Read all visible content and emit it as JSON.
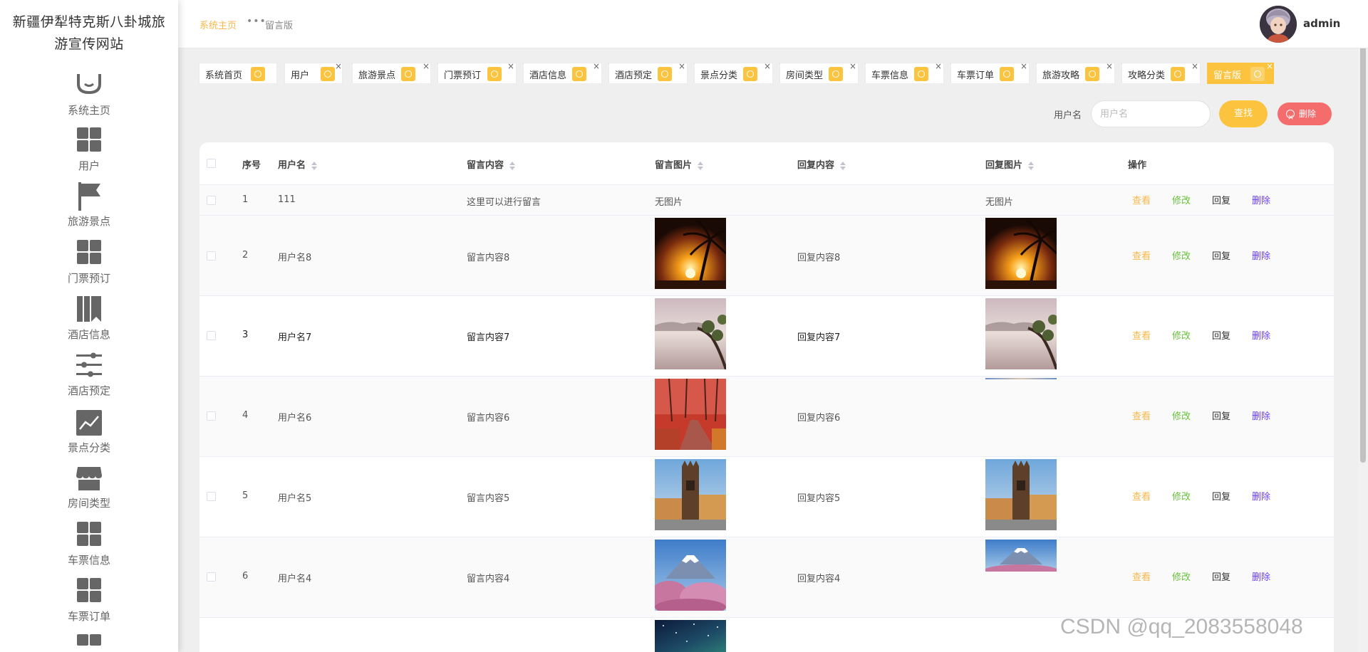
{
  "site": {
    "title_line1": "新疆伊犁特克斯八卦城旅",
    "title_line2": "游宣传网站"
  },
  "sidebar": {
    "items": [
      {
        "label": "系统主页",
        "icon": "home-icon"
      },
      {
        "label": "用户",
        "icon": "grid-icon"
      },
      {
        "label": "旅游景点",
        "icon": "flag-icon"
      },
      {
        "label": "门票预订",
        "icon": "grid-icon"
      },
      {
        "label": "酒店信息",
        "icon": "book-icon"
      },
      {
        "label": "酒店预定",
        "icon": "sliders-icon"
      },
      {
        "label": "景点分类",
        "icon": "chart-icon"
      },
      {
        "label": "房间类型",
        "icon": "shop-icon"
      },
      {
        "label": "车票信息",
        "icon": "grid-icon"
      },
      {
        "label": "车票订单",
        "icon": "grid-icon"
      }
    ]
  },
  "breadcrumb": {
    "home": "系统主页",
    "dots": "•••",
    "current": "留言版"
  },
  "user": {
    "name": "admin"
  },
  "tags": [
    {
      "label": "系统首页"
    },
    {
      "label": "用户"
    },
    {
      "label": "旅游景点"
    },
    {
      "label": "门票预订"
    },
    {
      "label": "酒店信息"
    },
    {
      "label": "酒店预定"
    },
    {
      "label": "景点分类"
    },
    {
      "label": "房间类型"
    },
    {
      "label": "车票信息"
    },
    {
      "label": "车票订单"
    },
    {
      "label": "旅游攻略"
    },
    {
      "label": "攻略分类"
    },
    {
      "label": "留言版"
    }
  ],
  "search": {
    "label": "用户名",
    "placeholder": "用户名",
    "search_btn": "查找",
    "delete_btn": "删除"
  },
  "table": {
    "headers": {
      "index": "序号",
      "username": "用户名",
      "content": "留言内容",
      "image": "留言图片",
      "reply": "回复内容",
      "reply_image": "回复图片",
      "actions": "操作"
    },
    "actions": {
      "view": "查看",
      "edit": "修改",
      "reply": "回复",
      "delete": "删除"
    },
    "no_image": "无图片",
    "rows": [
      {
        "index": "1",
        "username": "111",
        "content": "这里可以进行留言",
        "image": "",
        "reply": "",
        "reply_image": ""
      },
      {
        "index": "2",
        "username": "用户名8",
        "content": "留言内容8",
        "image": "sunset-palm",
        "reply": "回复内容8",
        "reply_image": "sunset-palm"
      },
      {
        "index": "3",
        "username": "用户名7",
        "content": "留言内容7",
        "image": "misty-tree",
        "reply": "回复内容7",
        "reply_image": "misty-tree"
      },
      {
        "index": "4",
        "username": "用户名6",
        "content": "留言内容6",
        "image": "autumn-path",
        "reply": "回复内容6",
        "reply_image": ""
      },
      {
        "index": "5",
        "username": "用户名5",
        "content": "留言内容5",
        "image": "old-tower",
        "reply": "回复内容5",
        "reply_image": "old-tower"
      },
      {
        "index": "6",
        "username": "用户名4",
        "content": "留言内容4",
        "image": "fuji-blossom",
        "reply": "回复内容4",
        "reply_image": "fuji-blossom"
      },
      {
        "index": "",
        "username": "",
        "content": "",
        "image": "night-sky",
        "reply": "",
        "reply_image": ""
      }
    ]
  },
  "watermark": "CSDN @qq_2083558048",
  "colors": {
    "accent": "#fbc33e",
    "danger": "#f56c6c",
    "view": "#f7b84b",
    "edit": "#67c23a",
    "delete": "#6c3ef5"
  }
}
